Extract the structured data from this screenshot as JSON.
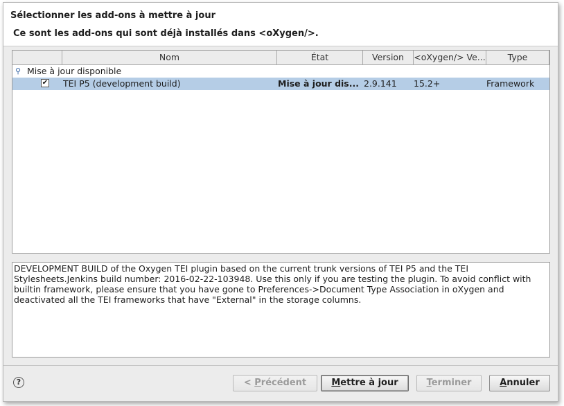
{
  "dialog": {
    "title": "Sélectionner les add-ons à mettre à jour",
    "subtitle": "Ce sont les add-ons qui sont déjà installés dans <oXygen/>."
  },
  "table": {
    "columns": [
      "",
      "Nom",
      "État",
      "Version",
      "<oXygen/> Ve...",
      "Type"
    ],
    "group_label": "Mise à jour disponible",
    "rows": [
      {
        "checked": true,
        "checkmark": "✔",
        "name": "TEI P5 (development build)",
        "state": "Mise à jour dis...",
        "version": "2.9.141",
        "oxygen_version": "15.2+",
        "type": "Framework"
      }
    ]
  },
  "description": {
    "lines": [
      "DEVELOPMENT BUILD of the Oxygen TEI plugin based on the current trunk versions of TEI P5 and the TEI",
      "Stylesheets.Jenkins build number: 2016-02-22-103948. Use this only if you are testing the plugin. To avoid conflict with",
      "builtin framework, please ensure that you have gone to Preferences->Document Type Association in oXygen and",
      "deactivated all the TEI frameworks that have \"External\" in the storage columns."
    ]
  },
  "footer": {
    "help_symbol": "?",
    "buttons": {
      "back_prefix": "< ",
      "back_mnemonic": "P",
      "back_rest": "récédent",
      "update_mnemonic": "M",
      "update_rest": "ettre à jour",
      "finish_mnemonic": "T",
      "finish_rest": "erminer",
      "cancel_mnemonic": "A",
      "cancel_rest": "nnuler"
    }
  },
  "colors": {
    "selection": "#b5cde6",
    "dialog_bg": "#ececec"
  }
}
